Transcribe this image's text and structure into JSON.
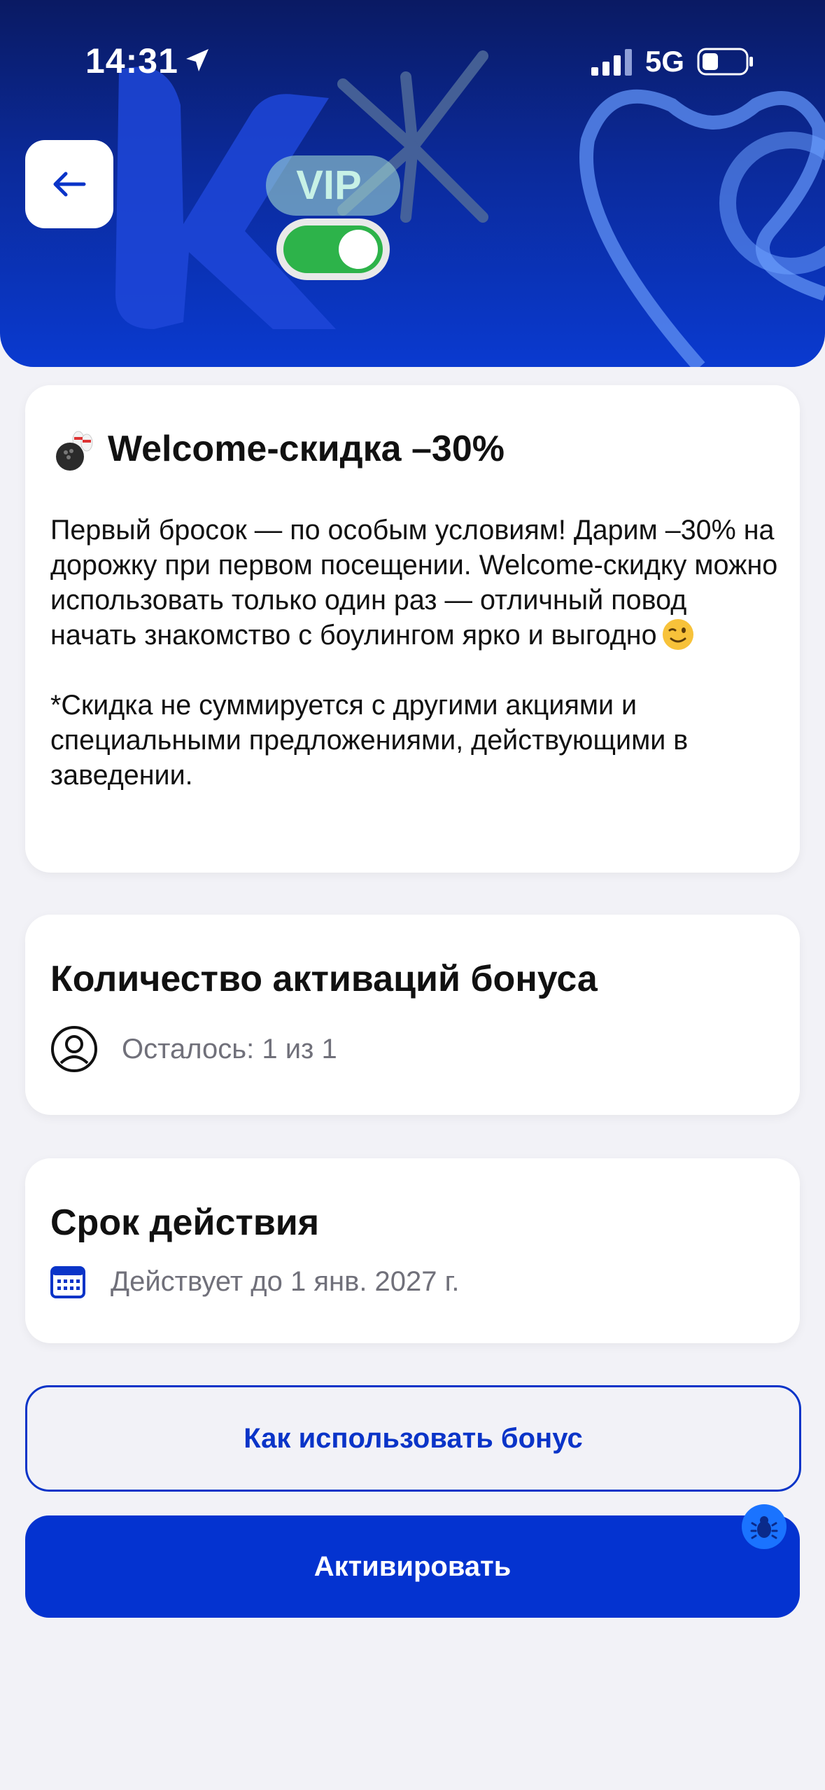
{
  "status_bar": {
    "time": "14:31",
    "network": "5G"
  },
  "hero": {
    "badge": "VIP"
  },
  "promo": {
    "title": "Welcome-скидка –30%",
    "description": "Первый бросок — по особым условиям! Дарим –30% на дорожку при первом посещении. Welcome-скидку можно использовать только один раз — отличный повод начать знакомство с боулингом ярко и выгодно",
    "disclaimer": "*Скидка не суммируется с другими акциями и специальными предложениями, действующими в заведении."
  },
  "activations": {
    "title": "Количество активаций бонуса",
    "remaining": "Осталось: 1 из 1"
  },
  "validity": {
    "title": "Срок действия",
    "until": "Действует до 1 янв. 2027 г."
  },
  "buttons": {
    "how_to_use": "Как использовать бонус",
    "activate": "Активировать"
  },
  "colors": {
    "accent": "#0433d0",
    "hero_top": "#0a1a63",
    "hero_bottom": "#0a3ad0",
    "background": "#f2f2f7"
  },
  "icons": {
    "promo_emoji": "bowling-icon",
    "wink": "wink-emoji-icon",
    "activations": "user-circle-icon",
    "validity": "calendar-icon",
    "back": "arrow-left-icon",
    "debug": "bug-icon"
  }
}
